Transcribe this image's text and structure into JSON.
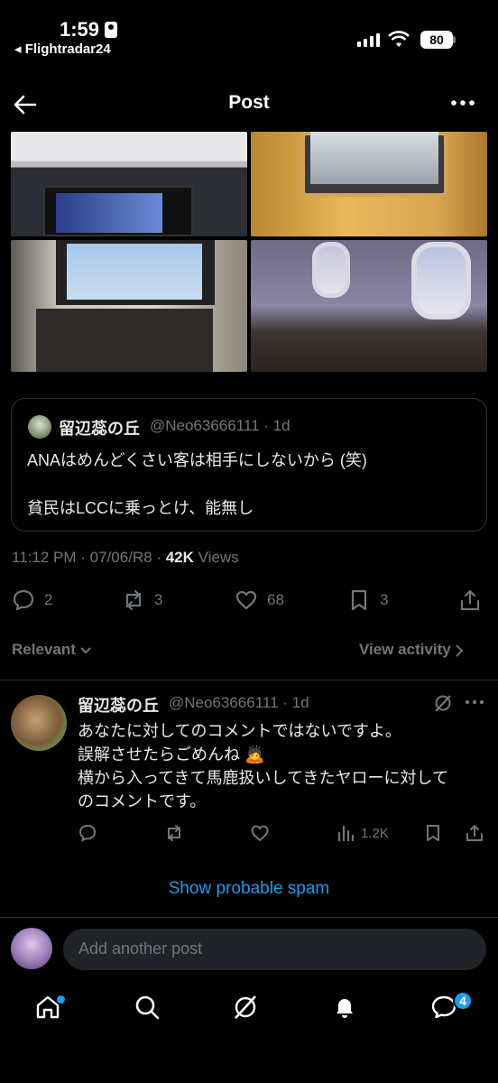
{
  "status_bar": {
    "time": "1:59",
    "back_app": "◂ Flightradar24",
    "battery": "80"
  },
  "header": {
    "title": "Post"
  },
  "quote": {
    "name": "留辺蕊の丘",
    "handle": "@Neo63666111 · 1d",
    "line1": "ANAはめんどくさい客は相手にしないから (笑)",
    "line2": "貧民はLCCに乗っとけ、能無し"
  },
  "meta": {
    "time_date": "11:12 PM · 07/06/R8 · ",
    "views_count": "42K",
    "views_label": " Views"
  },
  "actions": {
    "replies": "2",
    "reposts": "3",
    "likes": "68",
    "bookmarks": "3"
  },
  "sort": {
    "relevant": "Relevant",
    "view_activity": "View activity"
  },
  "reply": {
    "name": "留辺蕊の丘",
    "handle": "@Neo63666111 · 1d",
    "line1": "あなたに対してのコメントではないですよ。",
    "line2": "誤解させたらごめんね 🙇",
    "line3": "横から入ってきて馬鹿扱いしてきたヤローに対して",
    "line4": "のコメントです。",
    "views": "1.2K"
  },
  "spam_link": "Show probable spam",
  "compose": {
    "placeholder": "Add another post"
  },
  "nav": {
    "messages_badge": "4"
  },
  "colors": {
    "accent": "#1d9bf0",
    "background": "#000000",
    "muted": "#71767b"
  }
}
